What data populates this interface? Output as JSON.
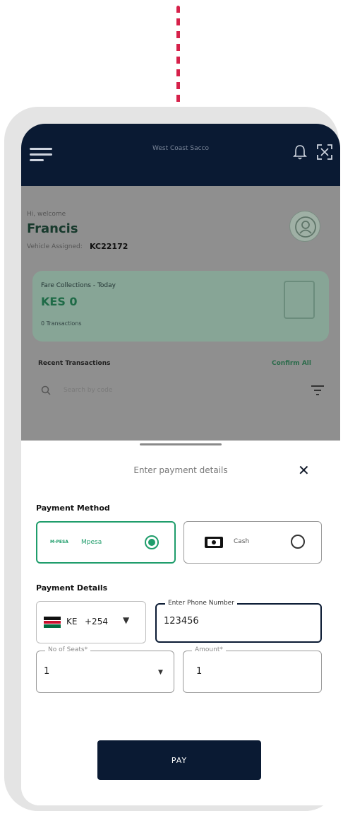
{
  "app": {
    "title": "West Coast Sacco"
  },
  "profile": {
    "greeting": "Hi, welcome",
    "name": "Francis",
    "vehicle_label": "Vehicle Assigned:",
    "vehicle": "KC22172"
  },
  "fare": {
    "title": "Fare Collections - Today",
    "amount": "KES 0",
    "transactions": "0 Transactions"
  },
  "recent": {
    "title": "Recent Transactions",
    "confirm_all": "Confirm All",
    "search_placeholder": "Search by code"
  },
  "sheet": {
    "title": "Enter payment details"
  },
  "payment_method": {
    "label": "Payment Method",
    "options": [
      {
        "brand": "M-PESA",
        "label": "Mpesa",
        "selected": true
      },
      {
        "label": "Cash",
        "selected": false
      }
    ]
  },
  "payment_details": {
    "label": "Payment Details",
    "country_code": "KE",
    "dial_code": "+254",
    "phone": {
      "legend": "Enter Phone Number",
      "value": "123456"
    },
    "seats": {
      "legend": "No of Seats*",
      "value": "1"
    },
    "amount": {
      "legend": "Amount*",
      "value": "1"
    }
  },
  "pay_button": "PAY",
  "colors": {
    "navy": "#0a1a33",
    "green": "#1f9d6b",
    "accent_red": "#d6214a"
  }
}
